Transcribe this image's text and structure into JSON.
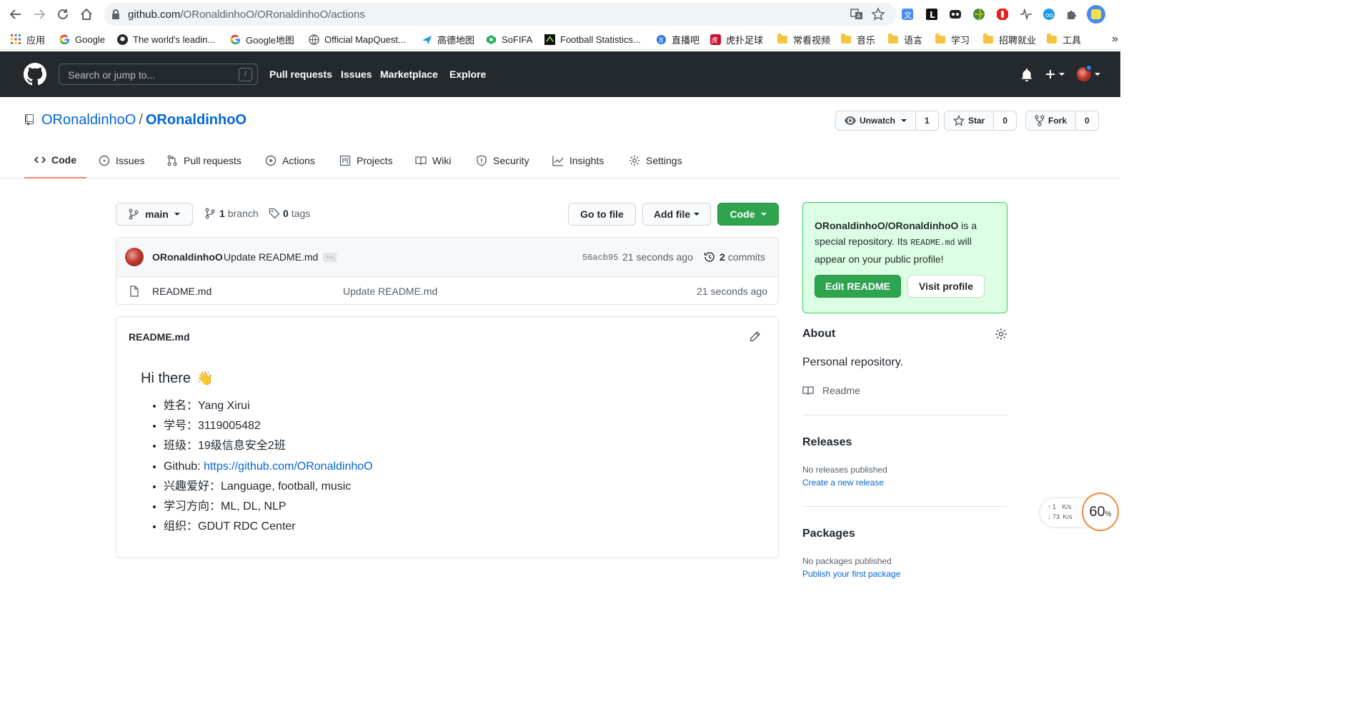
{
  "browser": {
    "url_host": "github.com",
    "url_path": "/ORonaldinhoO/ORonaldinhoO/actions",
    "bookmarks": [
      {
        "label": "应用",
        "icon": "apps-grid-icon"
      },
      {
        "label": "Google",
        "icon": "google-icon"
      },
      {
        "label": "The world's leadin...",
        "icon": "github-icon"
      },
      {
        "label": "Google地图",
        "icon": "google-icon"
      },
      {
        "label": "Official MapQuest...",
        "icon": "globe-icon"
      },
      {
        "label": "高德地图",
        "icon": "amap-icon"
      },
      {
        "label": "SoFIFA",
        "icon": "sofifa-icon"
      },
      {
        "label": "Football Statistics...",
        "icon": "whoscored-icon"
      },
      {
        "label": "直播吧",
        "icon": "zhibo8-icon"
      },
      {
        "label": "虎扑足球",
        "icon": "hupu-icon"
      },
      {
        "label": "常看视频",
        "icon": "folder-icon"
      },
      {
        "label": "音乐",
        "icon": "folder-icon"
      },
      {
        "label": "语言",
        "icon": "folder-icon"
      },
      {
        "label": "学习",
        "icon": "folder-icon"
      },
      {
        "label": "招聘就业",
        "icon": "folder-icon"
      },
      {
        "label": "工具",
        "icon": "folder-icon"
      }
    ],
    "overflow": "»"
  },
  "header": {
    "search_placeholder": "Search or jump to...",
    "search_shortcut": "/",
    "nav": [
      "Pull requests",
      "Issues",
      "Marketplace",
      "Explore"
    ]
  },
  "repo": {
    "owner": "ORonaldinhoO",
    "separator": "/",
    "name": "ORonaldinhoO",
    "watch_label": "Unwatch",
    "watch_count": "1",
    "star_label": "Star",
    "star_count": "0",
    "fork_label": "Fork",
    "fork_count": "0"
  },
  "tabs": [
    "Code",
    "Issues",
    "Pull requests",
    "Actions",
    "Projects",
    "Wiki",
    "Security",
    "Insights",
    "Settings"
  ],
  "toolbar": {
    "branch": "main",
    "branch_count": "1",
    "branch_word": "branch",
    "tag_count": "0",
    "tag_word": "tags",
    "go_to_file": "Go to file",
    "add_file": "Add file",
    "code": "Code"
  },
  "commit": {
    "author": "ORonaldinhoO",
    "message": "Update README.md",
    "ellipsis": "…",
    "sha": "56acb95",
    "time": "21 seconds ago",
    "commit_count": "2",
    "commit_word": "commits"
  },
  "files": [
    {
      "name": "README.md",
      "message": "Update README.md",
      "time": "21 seconds ago"
    }
  ],
  "readme": {
    "header": "README.md",
    "title": "Hi there",
    "emoji": "👋",
    "items": [
      "姓名：Yang Xirui",
      "学号：3119005482",
      "班级：19级信息安全2班",
      "Github: ",
      "兴趣爱好：Language, football, music",
      "学习方向：ML, DL, NLP",
      "组织：GDUT RDC Center"
    ],
    "github_link": "https://github.com/ORonaldinhoO"
  },
  "sidebar": {
    "callout_repo": "ORonaldinhoO/ORonaldinhoO",
    "callout_text_1": " is a special repository. Its ",
    "callout_code": "README.md",
    "callout_text_2": " will appear on your public profile!",
    "edit_readme": "Edit README",
    "visit_profile": "Visit profile",
    "about_title": "About",
    "about_desc": "Personal repository.",
    "readme_label": "Readme",
    "releases_title": "Releases",
    "releases_none": "No releases published",
    "releases_link": "Create a new release",
    "packages_title": "Packages",
    "packages_none": "No packages published",
    "packages_link": "Publish your first package"
  },
  "speed_widget": {
    "up": "1",
    "down": "73",
    "unit": "K/s",
    "percent": "60",
    "percent_sign": "%"
  },
  "colors": {
    "header_bg": "#24292e",
    "link": "#0366d6",
    "green": "#2ea44f",
    "active_tab": "#f9826c",
    "callout_bg": "#dcffe4"
  }
}
